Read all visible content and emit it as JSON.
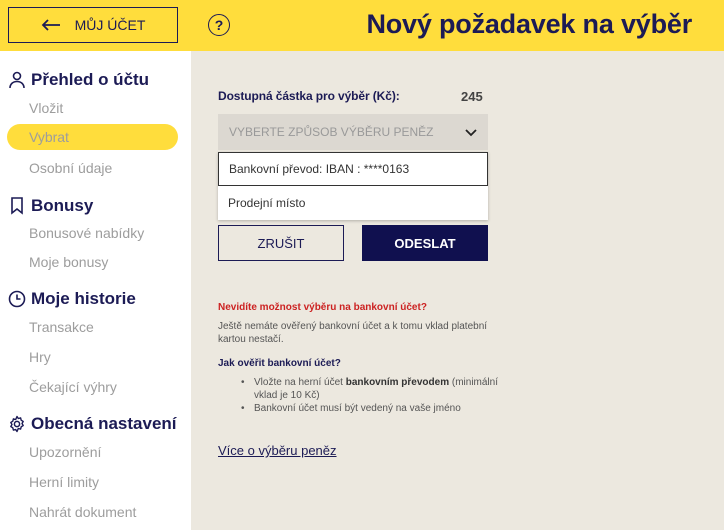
{
  "header": {
    "back_label": "MŮJ ÚČET",
    "help_symbol": "?",
    "title": "Nový požadavek na výběr"
  },
  "sidebar": {
    "sections": [
      {
        "title": "Přehled o účtu",
        "icon": "person-icon",
        "items": [
          {
            "label": "Vložit"
          },
          {
            "label": "Vybrat",
            "active": true
          },
          {
            "label": "Osobní údaje"
          }
        ]
      },
      {
        "title": "Bonusy",
        "icon": "bookmark-icon",
        "items": [
          {
            "label": "Bonusové nabídky"
          },
          {
            "label": "Moje bonusy"
          }
        ]
      },
      {
        "title": "Moje historie",
        "icon": "clock-icon",
        "items": [
          {
            "label": "Transakce"
          },
          {
            "label": "Hry"
          },
          {
            "label": "Čekající výhry"
          }
        ]
      },
      {
        "title": "Obecná nastavení",
        "icon": "gear-icon",
        "items": [
          {
            "label": "Upozornění"
          },
          {
            "label": "Herní limity"
          },
          {
            "label": "Nahrát dokument"
          }
        ]
      }
    ]
  },
  "withdraw": {
    "amount_label": "Dostupná částka pro výběr (Kč):",
    "amount_value": "245",
    "select_placeholder": "VYBERTE ZPŮSOB VÝBĚRU PENĚZ",
    "options": [
      "Bankovní převod: IBAN : ****0163",
      "Prodejní místo"
    ],
    "cancel_label": "ZRUŠIT",
    "submit_label": "ODESLAT"
  },
  "info": {
    "q1": "Nevidíte možnost výběru na bankovní účet?",
    "a1": "Ještě nemáte ověřený bankovní účet a k tomu vklad platební kartou nestačí.",
    "q2": "Jak ověřit bankovní účet?",
    "bullet1_pre": "Vložte na herní účet ",
    "bullet1_bold": "bankovním převodem",
    "bullet1_post": " (minimální vklad je 10 Kč)",
    "bullet2": "Bankovní účet musí být vedený na vaše jméno",
    "more_link": "Více o výběru peněz"
  },
  "colors": {
    "accent": "#ffdd3c",
    "navy": "#1c1b55",
    "button": "#10104f",
    "warning": "#cc2222"
  }
}
